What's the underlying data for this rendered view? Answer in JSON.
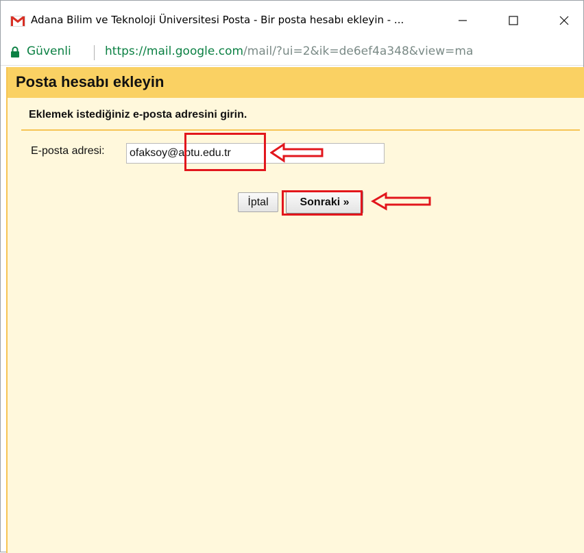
{
  "window": {
    "title": "Adana Bilim ve Teknoloji Üniversitesi Posta - Bir posta hesabı ekleyin - ...",
    "icon": "gmail-icon",
    "controls": [
      "minimize-icon",
      "maximize-icon",
      "close-icon"
    ]
  },
  "address_bar": {
    "secure_label": "Güvenli",
    "url_host": "https://mail.google.com",
    "url_path": "/mail/?ui=2&ik=de6ef4a348&view=ma"
  },
  "dialog": {
    "title": "Posta hesabı ekleyin",
    "instruction": "Eklemek istediğiniz e-posta adresini girin.",
    "email_label": "E-posta adresi:",
    "email_value": "ofaksoy@abtu.edu.tr",
    "cancel_label": "İptal",
    "next_label": "Sonraki »"
  },
  "colors": {
    "header_bar": "#fad163",
    "content_bg": "#fff8dc",
    "accent_border": "#f6c453",
    "annotation_red": "#e2161c",
    "secure_green": "#0b8043"
  }
}
